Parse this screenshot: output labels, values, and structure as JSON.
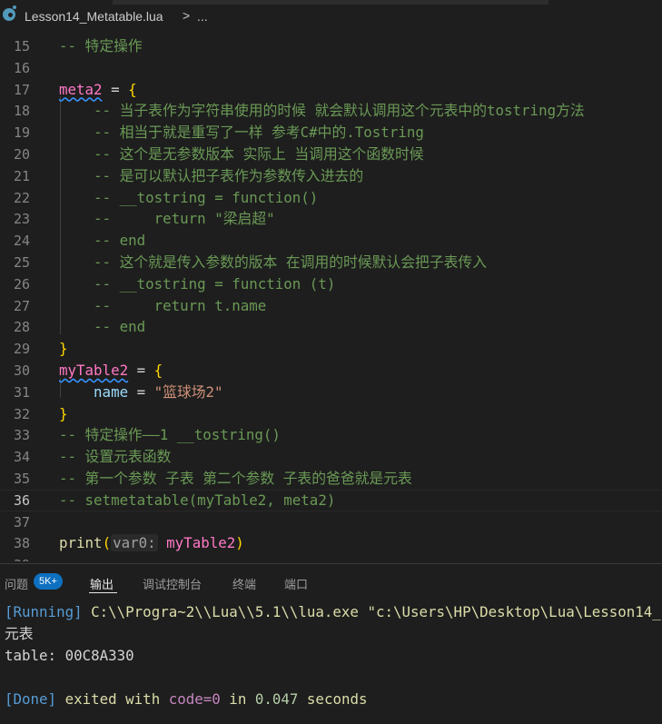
{
  "breadcrumb": {
    "file_name": "Lesson14_Metatable.lua",
    "separator": ">",
    "more": "..."
  },
  "editor": {
    "lines": [
      {
        "num": "15",
        "tokens": [
          {
            "t": "-- 特定操作",
            "c": "c"
          }
        ]
      },
      {
        "num": "16",
        "tokens": []
      },
      {
        "num": "17",
        "tokens": [
          {
            "t": "meta2",
            "c": "v squig"
          },
          {
            "t": " = ",
            "c": ""
          },
          {
            "t": "{",
            "c": "b1"
          }
        ]
      },
      {
        "num": "18",
        "tokens": [
          {
            "t": "    -- 当子表作为字符串使用的时候 就会默认调用这个元表中的tostring方法",
            "c": "c"
          }
        ]
      },
      {
        "num": "19",
        "tokens": [
          {
            "t": "    -- 相当于就是重写了一样 参考C#中的.Tostring",
            "c": "c"
          }
        ]
      },
      {
        "num": "20",
        "tokens": [
          {
            "t": "    -- 这个是无参数版本 实际上 当调用这个函数时候",
            "c": "c"
          }
        ]
      },
      {
        "num": "21",
        "tokens": [
          {
            "t": "    -- 是可以默认把子表作为参数传入进去的",
            "c": "c"
          }
        ]
      },
      {
        "num": "22",
        "tokens": [
          {
            "t": "    -- __tostring = function()",
            "c": "c"
          }
        ]
      },
      {
        "num": "23",
        "tokens": [
          {
            "t": "    --     return \"梁启超\"",
            "c": "c"
          }
        ]
      },
      {
        "num": "24",
        "tokens": [
          {
            "t": "    -- end",
            "c": "c"
          }
        ]
      },
      {
        "num": "25",
        "tokens": [
          {
            "t": "    -- 这个就是传入参数的版本 在调用的时候默认会把子表传入",
            "c": "c"
          }
        ]
      },
      {
        "num": "26",
        "tokens": [
          {
            "t": "    -- __tostring = function (t)",
            "c": "c"
          }
        ]
      },
      {
        "num": "27",
        "tokens": [
          {
            "t": "    --     return t.name",
            "c": "c"
          }
        ]
      },
      {
        "num": "28",
        "tokens": [
          {
            "t": "    -- end",
            "c": "c"
          }
        ]
      },
      {
        "num": "29",
        "tokens": [
          {
            "t": "}",
            "c": "b1"
          }
        ]
      },
      {
        "num": "30",
        "tokens": [
          {
            "t": "myTable2",
            "c": "v squig"
          },
          {
            "t": " = ",
            "c": ""
          },
          {
            "t": "{",
            "c": "b1"
          }
        ]
      },
      {
        "num": "31",
        "tokens": [
          {
            "t": "    ",
            "c": ""
          },
          {
            "t": "name",
            "c": "p"
          },
          {
            "t": " = ",
            "c": ""
          },
          {
            "t": "\"篮球场2\"",
            "c": "s"
          }
        ]
      },
      {
        "num": "32",
        "tokens": [
          {
            "t": "}",
            "c": "b1"
          }
        ]
      },
      {
        "num": "33",
        "tokens": [
          {
            "t": "-- 特定操作——1 __tostring()",
            "c": "c"
          }
        ]
      },
      {
        "num": "34",
        "tokens": [
          {
            "t": "-- 设置元表函数",
            "c": "c"
          }
        ]
      },
      {
        "num": "35",
        "tokens": [
          {
            "t": "-- 第一个参数 子表 第二个参数 子表的爸爸就是元表",
            "c": "c"
          }
        ]
      },
      {
        "num": "36",
        "tokens": [
          {
            "t": "-- setmetatable(myTable2, meta2)",
            "c": "c"
          }
        ],
        "active": true
      },
      {
        "num": "37",
        "tokens": []
      },
      {
        "num": "38",
        "tokens": [
          {
            "t": "print",
            "c": "f"
          },
          {
            "t": "(",
            "c": "b1"
          },
          {
            "t": "var0:",
            "c": "hint"
          },
          {
            "t": " ",
            "c": ""
          },
          {
            "t": "myTable2",
            "c": "v"
          },
          {
            "t": ")",
            "c": "b1"
          }
        ]
      },
      {
        "num": "39",
        "tokens": []
      }
    ]
  },
  "panel": {
    "tabs": [
      {
        "label": "问题",
        "active": false
      },
      {
        "label": "输出",
        "active": true
      },
      {
        "label": "调试控制台",
        "active": false
      },
      {
        "label": "终端",
        "active": false
      },
      {
        "label": "端口",
        "active": false
      }
    ],
    "problems_badge": "5K+",
    "output": {
      "running_tag": "[Running]",
      "running_cmd": " C:\\\\Progra~2\\\\Lua\\\\5.1\\\\lua.exe \"c:\\Users\\HP\\Desktop\\Lua\\Lesson14_",
      "line2": "元表",
      "line3": "table: 00C8A330",
      "done_tag": "[Done]",
      "done_exited": " exited with ",
      "done_code": "code=0",
      "done_in": " in ",
      "done_time": "0.047",
      "done_seconds": " seconds"
    }
  },
  "colors": {
    "background": "#1e1e1e",
    "comment": "#6a9955",
    "variable": "#ff79c6",
    "string": "#ce9178",
    "accent": "#0e70c0"
  }
}
